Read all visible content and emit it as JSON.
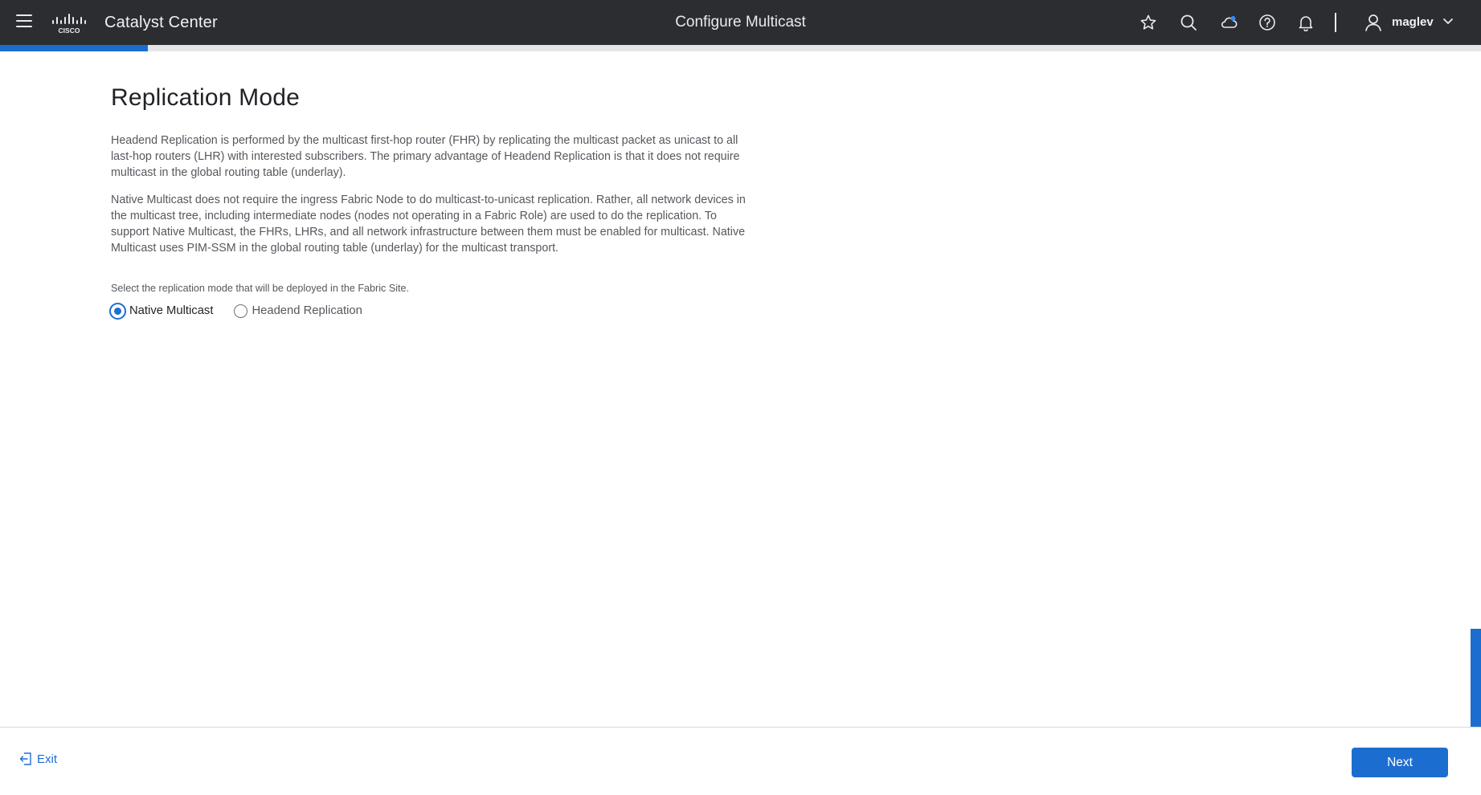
{
  "header": {
    "product_name": "Catalyst Center",
    "page_title": "Configure Multicast",
    "username": "maglev",
    "icons": [
      "menu-icon",
      "cisco-logo",
      "star-icon",
      "search-icon",
      "cloud-icon",
      "help-icon",
      "bell-icon",
      "user-icon",
      "chevron-down-icon"
    ]
  },
  "wizard": {
    "progress_percent": 10
  },
  "main": {
    "heading": "Replication Mode",
    "paragraph_1": "Headend Replication is performed by the multicast first-hop router (FHR) by replicating the multicast packet as unicast to all last-hop routers (LHR) with interested subscribers. The primary advantage of Headend Replication is that it does not require multicast in the global routing table (underlay).",
    "paragraph_2": "Native Multicast does not require the ingress Fabric Node to do multicast-to-unicast replication. Rather, all network devices in the multicast tree, including intermediate nodes (nodes not operating in a Fabric Role) are used to do the replication. To support Native Multicast, the FHRs, LHRs, and all network infrastructure between them must be enabled for multicast. Native Multicast uses PIM-SSM in the global routing table (underlay) for the multicast transport.",
    "select_label": "Select the replication mode that will be deployed in the Fabric Site.",
    "options": [
      {
        "label": "Native Multicast",
        "selected": true
      },
      {
        "label": "Headend Replication",
        "selected": false
      }
    ]
  },
  "footer": {
    "exit_label": "Exit",
    "next_label": "Next"
  },
  "colors": {
    "accent": "#1c6dd0",
    "topbar": "#2b2d30"
  }
}
